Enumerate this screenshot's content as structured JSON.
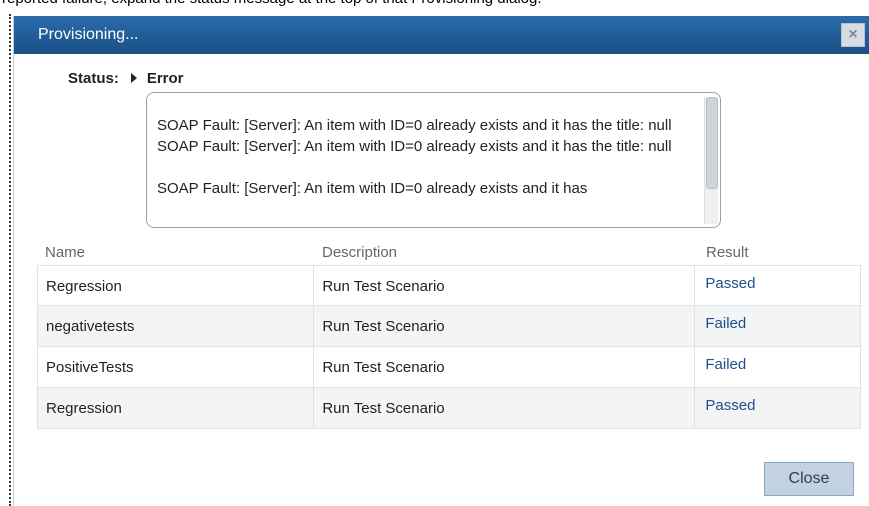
{
  "background_text": "reported failure, expand the status message at the top of that Provisioning dialog.",
  "dialog": {
    "title": "Provisioning...",
    "close_icon_glyph": "×",
    "status_label": "Status:",
    "status_value": "Error",
    "error_paragraphs": [
      "SOAP Fault: [Server]: An item with ID=0 already exists and it has the title: null SOAP Fault: [Server]: An item with ID=0 already exists and it has the title: null",
      "SOAP Fault: [Server]: An item with ID=0 already exists and it has"
    ],
    "table": {
      "headers": [
        "Name",
        "Description",
        "Result"
      ],
      "rows": [
        {
          "name": "Regression",
          "description": "Run Test Scenario",
          "result": "Passed"
        },
        {
          "name": "negativetests",
          "description": "Run Test Scenario",
          "result": "Failed"
        },
        {
          "name": "PositiveTests",
          "description": "Run Test Scenario",
          "result": "Failed"
        },
        {
          "name": "Regression",
          "description": "Run Test Scenario",
          "result": "Passed"
        }
      ]
    },
    "close_button_label": "Close"
  },
  "colors": {
    "titlebar": "#1f5d98",
    "result_link": "#1f4e8c",
    "close_button": "#c3d2e3"
  }
}
